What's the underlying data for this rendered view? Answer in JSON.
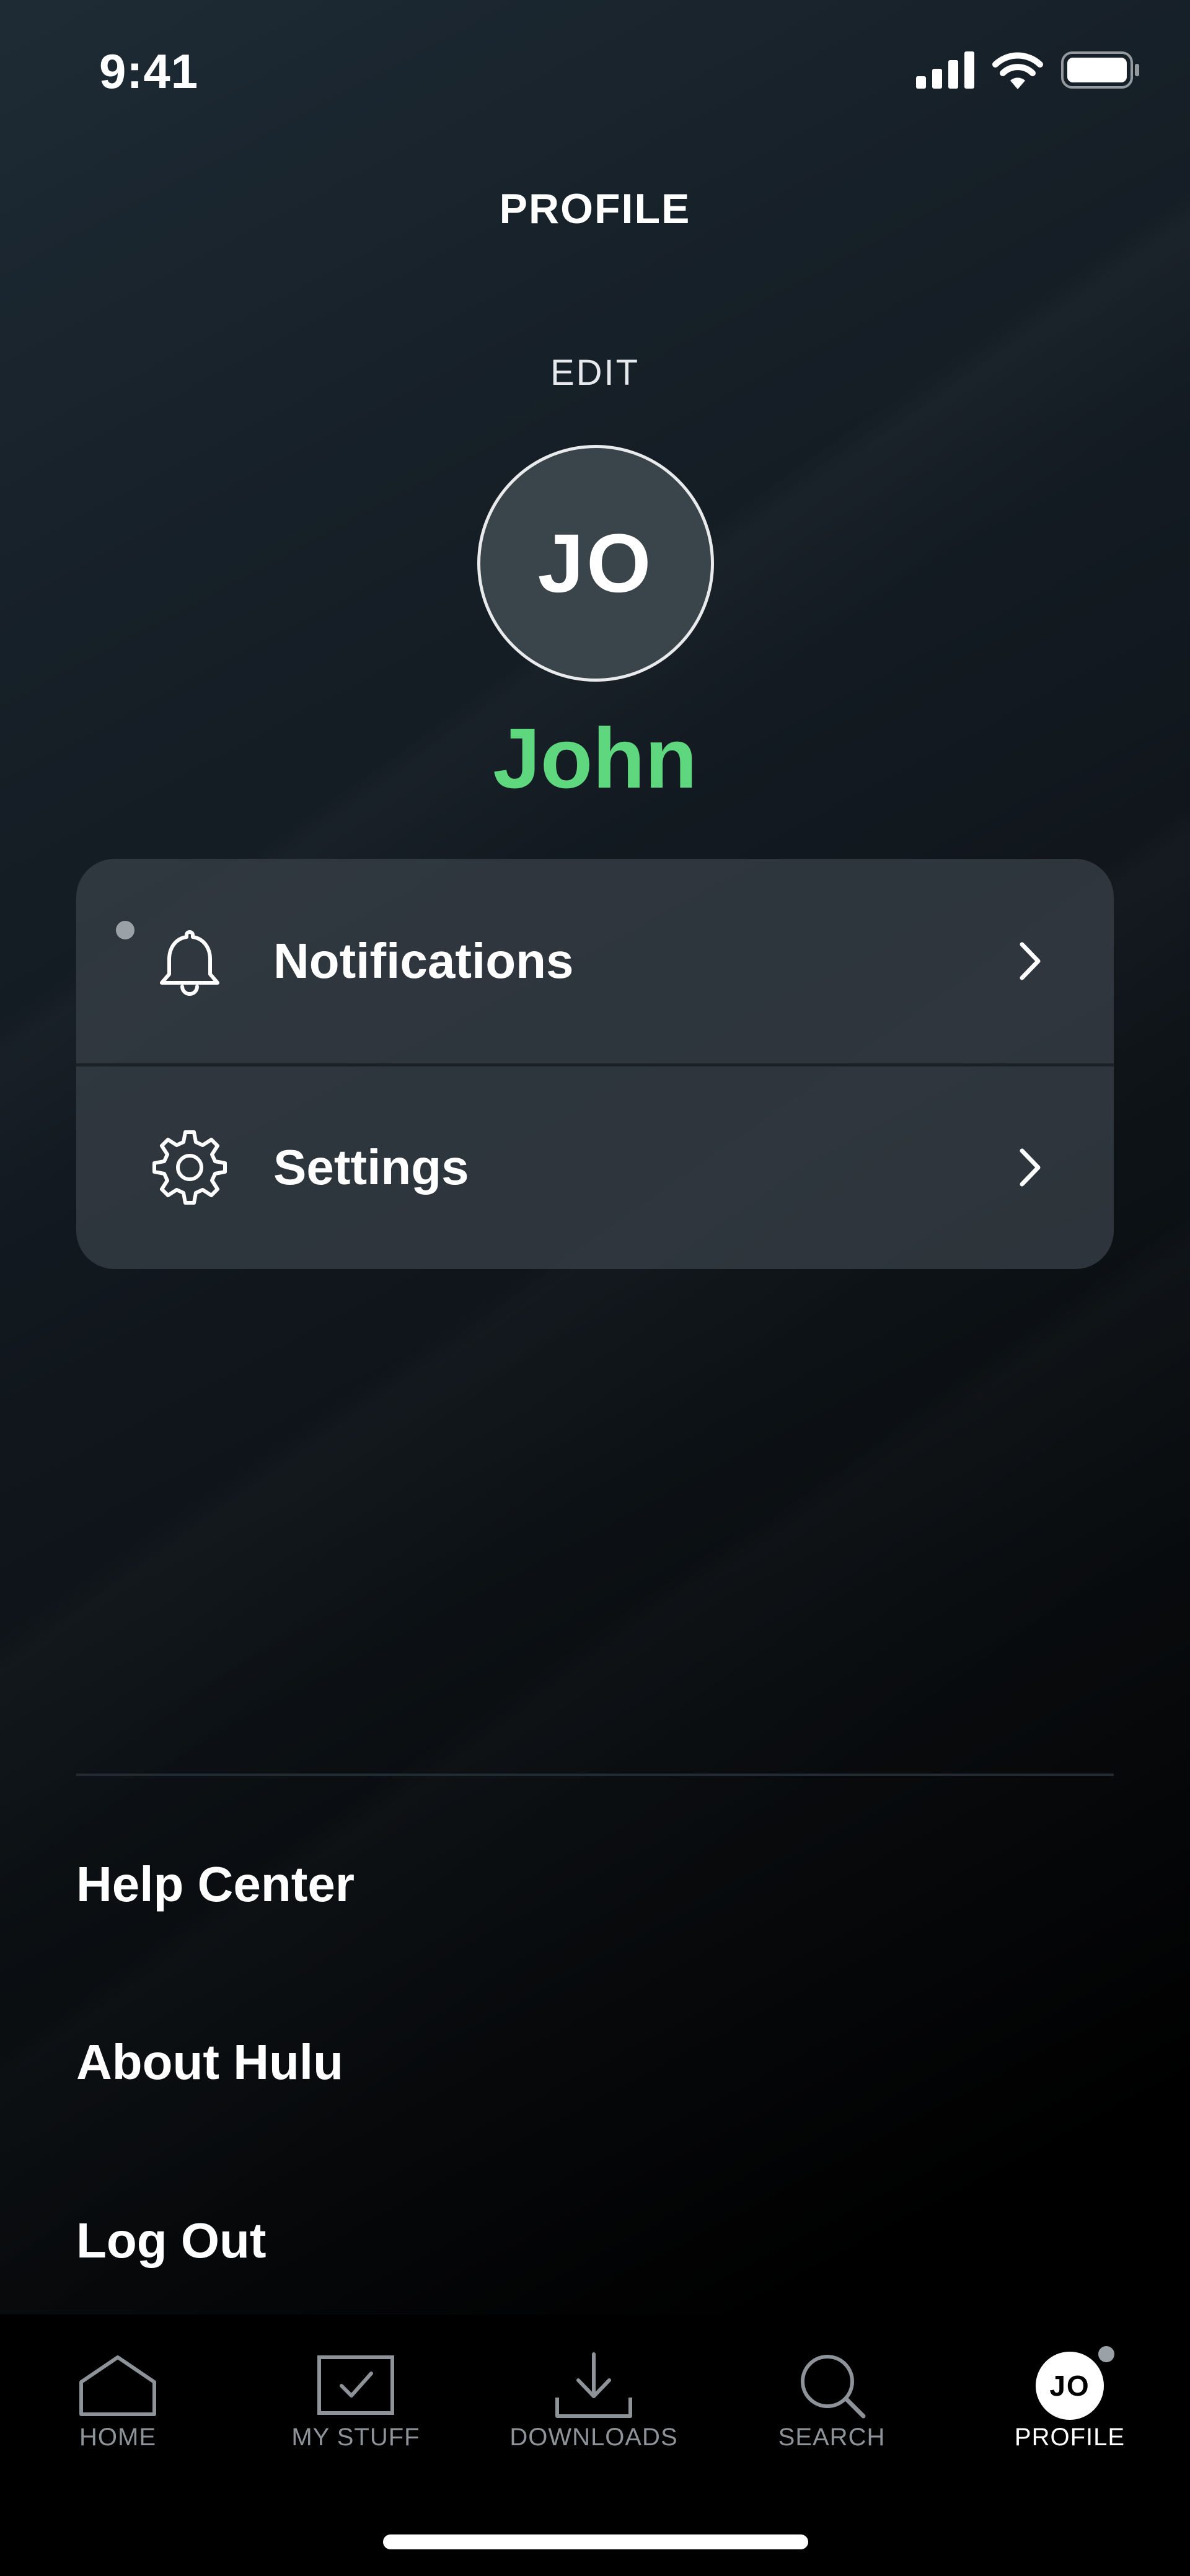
{
  "status_bar": {
    "time": "9:41"
  },
  "header": {
    "title": "PROFILE",
    "edit_label": "EDIT"
  },
  "profile": {
    "initials": "JO",
    "name": "John",
    "name_color": "#5fd77e"
  },
  "menu": {
    "items": [
      {
        "label": "Notifications",
        "icon": "bell-icon",
        "has_indicator": true
      },
      {
        "label": "Settings",
        "icon": "gear-icon"
      }
    ]
  },
  "links": [
    {
      "label": "Help Center"
    },
    {
      "label": "About Hulu"
    },
    {
      "label": "Log Out"
    }
  ],
  "tab_bar": {
    "tabs": [
      {
        "label": "HOME",
        "icon": "home-icon"
      },
      {
        "label": "MY STUFF",
        "icon": "my-stuff-icon"
      },
      {
        "label": "DOWNLOADS",
        "icon": "download-icon"
      },
      {
        "label": "SEARCH",
        "icon": "search-icon"
      },
      {
        "label": "PROFILE",
        "icon": "profile-avatar",
        "initials": "JO",
        "active": true
      }
    ]
  }
}
